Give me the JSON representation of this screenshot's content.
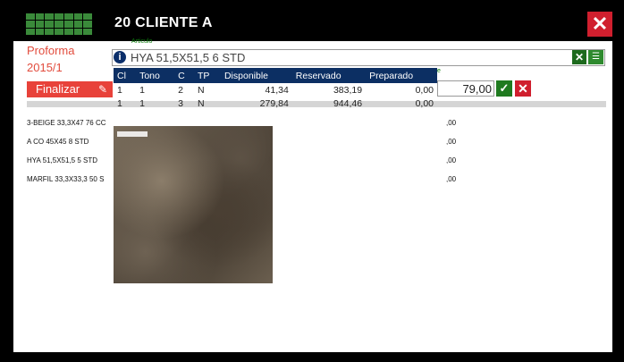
{
  "window": {
    "title": "20 CLIENTE A",
    "close_label": "✕"
  },
  "document": {
    "type_label": "Proforma",
    "number": "2015/1",
    "finalize_label": "Finalizar"
  },
  "articulo": {
    "label": "Articulo",
    "value": "HYA 51,5X51,5  6 STD"
  },
  "quantity": {
    "label": "e",
    "value": "79,00"
  },
  "stock_table": {
    "columns": [
      "Cl",
      "Tono",
      "C",
      "TP",
      "Disponible",
      "Reservado",
      "Preparado"
    ],
    "rows": [
      [
        "1",
        "1",
        "2",
        "N",
        "41,34",
        "383,19",
        "0,00"
      ],
      [
        "1",
        "1",
        "3",
        "N",
        "279,84",
        "944,46",
        "0,00"
      ]
    ]
  },
  "lines": {
    "left": [
      "3-BEIGE 33,3X47  76 CC",
      "A CO 45X45  8 STD",
      "HYA 51,5X51,5  5 STD",
      "MARFIL 33,3X33,3  50 S"
    ],
    "right": [
      ",00",
      ",00",
      ",00",
      ",00"
    ]
  },
  "colors": {
    "accent_red": "#e8423a",
    "header_blue": "#0c2f63",
    "confirm_green": "#1f7a1f",
    "close_red": "#d01f2e"
  },
  "icons": {
    "info": "info-icon",
    "clear": "clear-icon",
    "search": "search-icon",
    "pen": "pen-icon",
    "ok": "check-icon",
    "cancel": "close-icon"
  }
}
